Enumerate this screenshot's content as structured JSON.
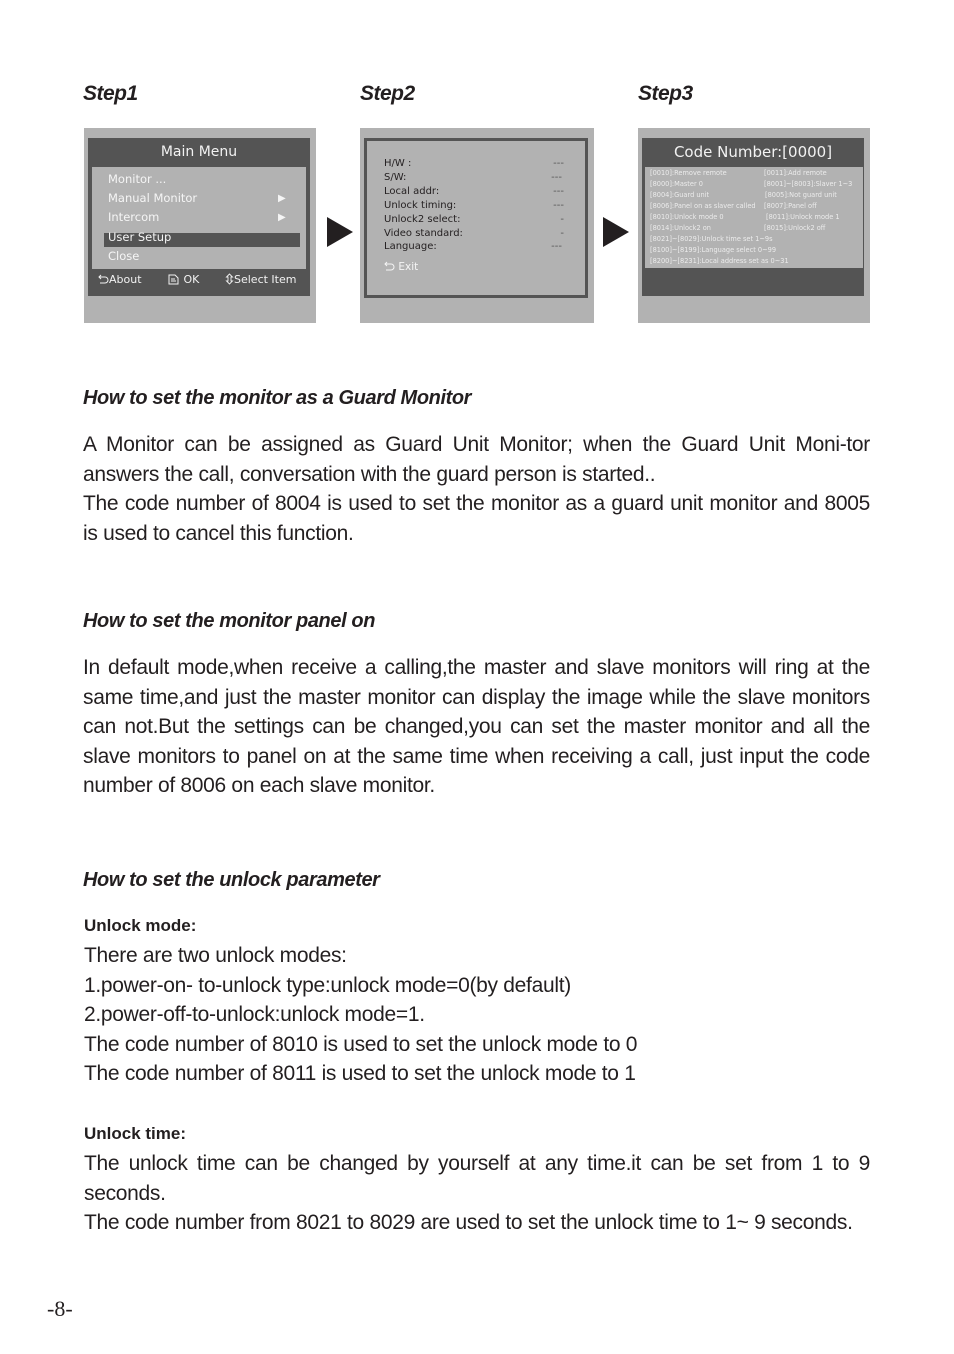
{
  "steps": {
    "labels": [
      "Step1",
      "Step2",
      "Step3"
    ],
    "step1": {
      "title": "Main Menu",
      "items": [
        {
          "label": "Monitor ...",
          "has_submenu": false,
          "selected": false
        },
        {
          "label": "Manual Monitor",
          "has_submenu": true,
          "selected": false
        },
        {
          "label": "Intercom",
          "has_submenu": true,
          "selected": false
        },
        {
          "label": "User Setup",
          "has_submenu": false,
          "selected": true
        },
        {
          "label": "Close",
          "has_submenu": false,
          "selected": false
        }
      ],
      "submenu_arrow": "▶",
      "footer": {
        "about_icon": "return-arrow-icon",
        "about": "About",
        "ok_icon": "document-icon",
        "ok": "OK",
        "select_icon": "up-down-arrow-icon",
        "select": "Select Item"
      }
    },
    "step2": {
      "rows": [
        {
          "label": "H/W :",
          "value": "---"
        },
        {
          "label": "S/W:",
          "value": "---"
        },
        {
          "label": "Local addr:",
          "value": "---"
        },
        {
          "label": "Unlock timing:",
          "value": "---"
        },
        {
          "label": "Unlock2 select:",
          "value": "-"
        },
        {
          "label": "Video standard:",
          "value": "-"
        },
        {
          "label": "Language:",
          "value": "---"
        }
      ],
      "exit_icon": "return-arrow-icon",
      "exit": "Exit"
    },
    "step3": {
      "title": "Code Number:[0000]",
      "rows": [
        {
          "left": "[0010]:Remove remote",
          "right": "[0011]:Add remote"
        },
        {
          "left": "[8000]:Master 0",
          "right": "[8001]~[8003]:Slaver 1~3"
        },
        {
          "left": "[8004]:Guard unit",
          "right": "[8005]:Not guard unit"
        },
        {
          "left": "[8006]:Panel on as slaver called",
          "right": "[8007]:Panel off"
        },
        {
          "left": "[8010]:Unlock mode 0",
          "right": "[8011]:Unlock mode 1"
        },
        {
          "left": "[8014]:Unlock2 on",
          "right": "[8015]:Unlock2 off"
        },
        {
          "left": "[8021]~[8029]:Unlock time set 1~9s",
          "right": ""
        },
        {
          "left": "[8100]~[8199]:Language select 0~99",
          "right": ""
        },
        {
          "left": "[8200]~[8231]:Local address set as 0~31",
          "right": ""
        }
      ]
    }
  },
  "sections": {
    "guard": {
      "heading": "How to set the monitor as a Guard Monitor",
      "paragraphs": [
        "A Monitor can be assigned as Guard Unit Monitor; when the Guard Unit Moni-tor answers the call, conversation with the guard person is started..",
        "The code number of 8004 is used to set the monitor as a guard unit monitor and 8005 is used to cancel this function."
      ]
    },
    "panel": {
      "heading": "How to set the  monitor panel on",
      "paragraphs": [
        "In default mode,when receive a calling,the master and slave monitors will ring at the same time,and just the master monitor can display the image while the slave monitors can not.But the settings can be changed,you can set the master monitor and all the slave monitors to panel on at the same time when receiving a call, just input the code number of 8006  on each slave monitor."
      ]
    },
    "unlock": {
      "heading": "How to set the unlock parameter",
      "mode_title": "Unlock mode:",
      "mode_lines": [
        "There are two unlock modes:",
        "1.power-on- to-unlock type:unlock mode=0(by default)",
        "2.power-off-to-unlock:unlock mode=1.",
        "The code number of 8010 is used to set the unlock mode to 0",
        "The code number of 8011 is used to set the unlock mode to 1"
      ],
      "time_title": "Unlock time:",
      "time_paragraphs": [
        "The unlock time can be changed by yourself at any time.it can be set from 1 to 9 seconds.",
        "The code number from 8021 to 8029 are used to set the unlock time to 1~ 9 seconds."
      ]
    }
  },
  "page_number": "-8-"
}
